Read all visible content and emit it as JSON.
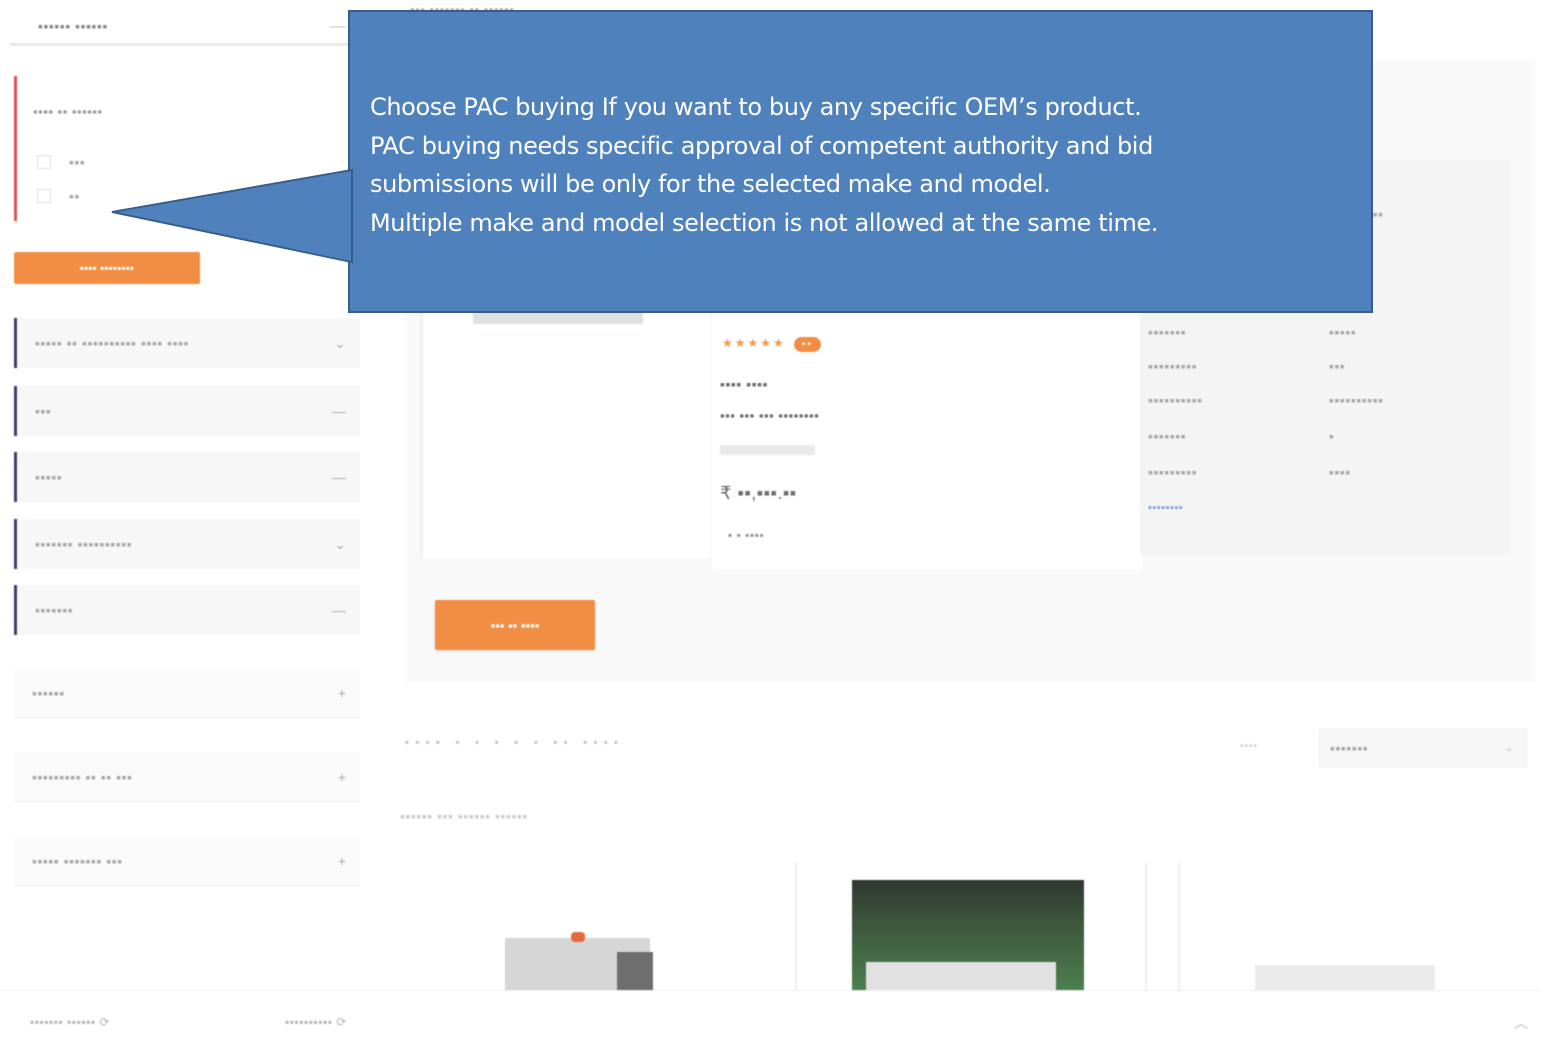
{
  "callout": {
    "lines": [
      "Choose PAC buying If you want to buy any specific OEM’s product.",
      "PAC buying needs specific approval of competent  authority and bid",
      "submissions will be only for the selected make and model.",
      "Multiple make and model selection is not allowed at the same time."
    ],
    "fill": "#4f81bd",
    "border": "#385d8a"
  },
  "colors": {
    "accent_orange": "#f07a24",
    "sidebar_red": "#dd3333",
    "sidebar_navy": "#1c1c5c"
  },
  "icons": {
    "collapse": "minus-icon",
    "expand": "plus-icon",
    "dropdown": "chevron-down-icon",
    "scroll_top": "chevron-up-icon"
  }
}
